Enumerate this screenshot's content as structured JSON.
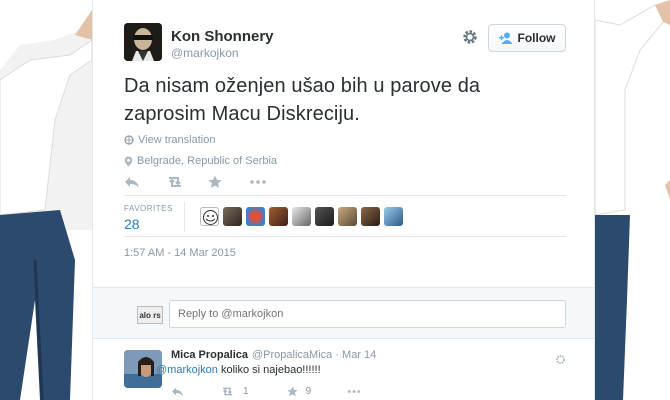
{
  "author": {
    "name": "Kon Shonnery",
    "handle": "@markojkon"
  },
  "header": {
    "follow_label": "Follow"
  },
  "tweet": {
    "text": "Da nisam oženjen ušao bih u parove da zaprosim Macu Diskreciju.",
    "translate_label": "View translation",
    "location": "Belgrade, Republic of Serbia",
    "timestamp": "1:57 AM - 14 Mar 2015"
  },
  "stats": {
    "favorites_label": "FAVORITES",
    "favorites_count": "28"
  },
  "reply_box": {
    "placeholder": "Reply to @markojkon",
    "avatar_text": "alo rs"
  },
  "reply": {
    "name": "Mica Propalica",
    "handle_date": "@PropalicaMica · Mar 14",
    "mention": "@markojkon",
    "text": " koliko si najebao!!!!!!",
    "retweets": "1",
    "favorites": "9"
  },
  "colors": {
    "link": "#2b7bb9",
    "muted": "#8899a6",
    "text": "#292f33"
  }
}
